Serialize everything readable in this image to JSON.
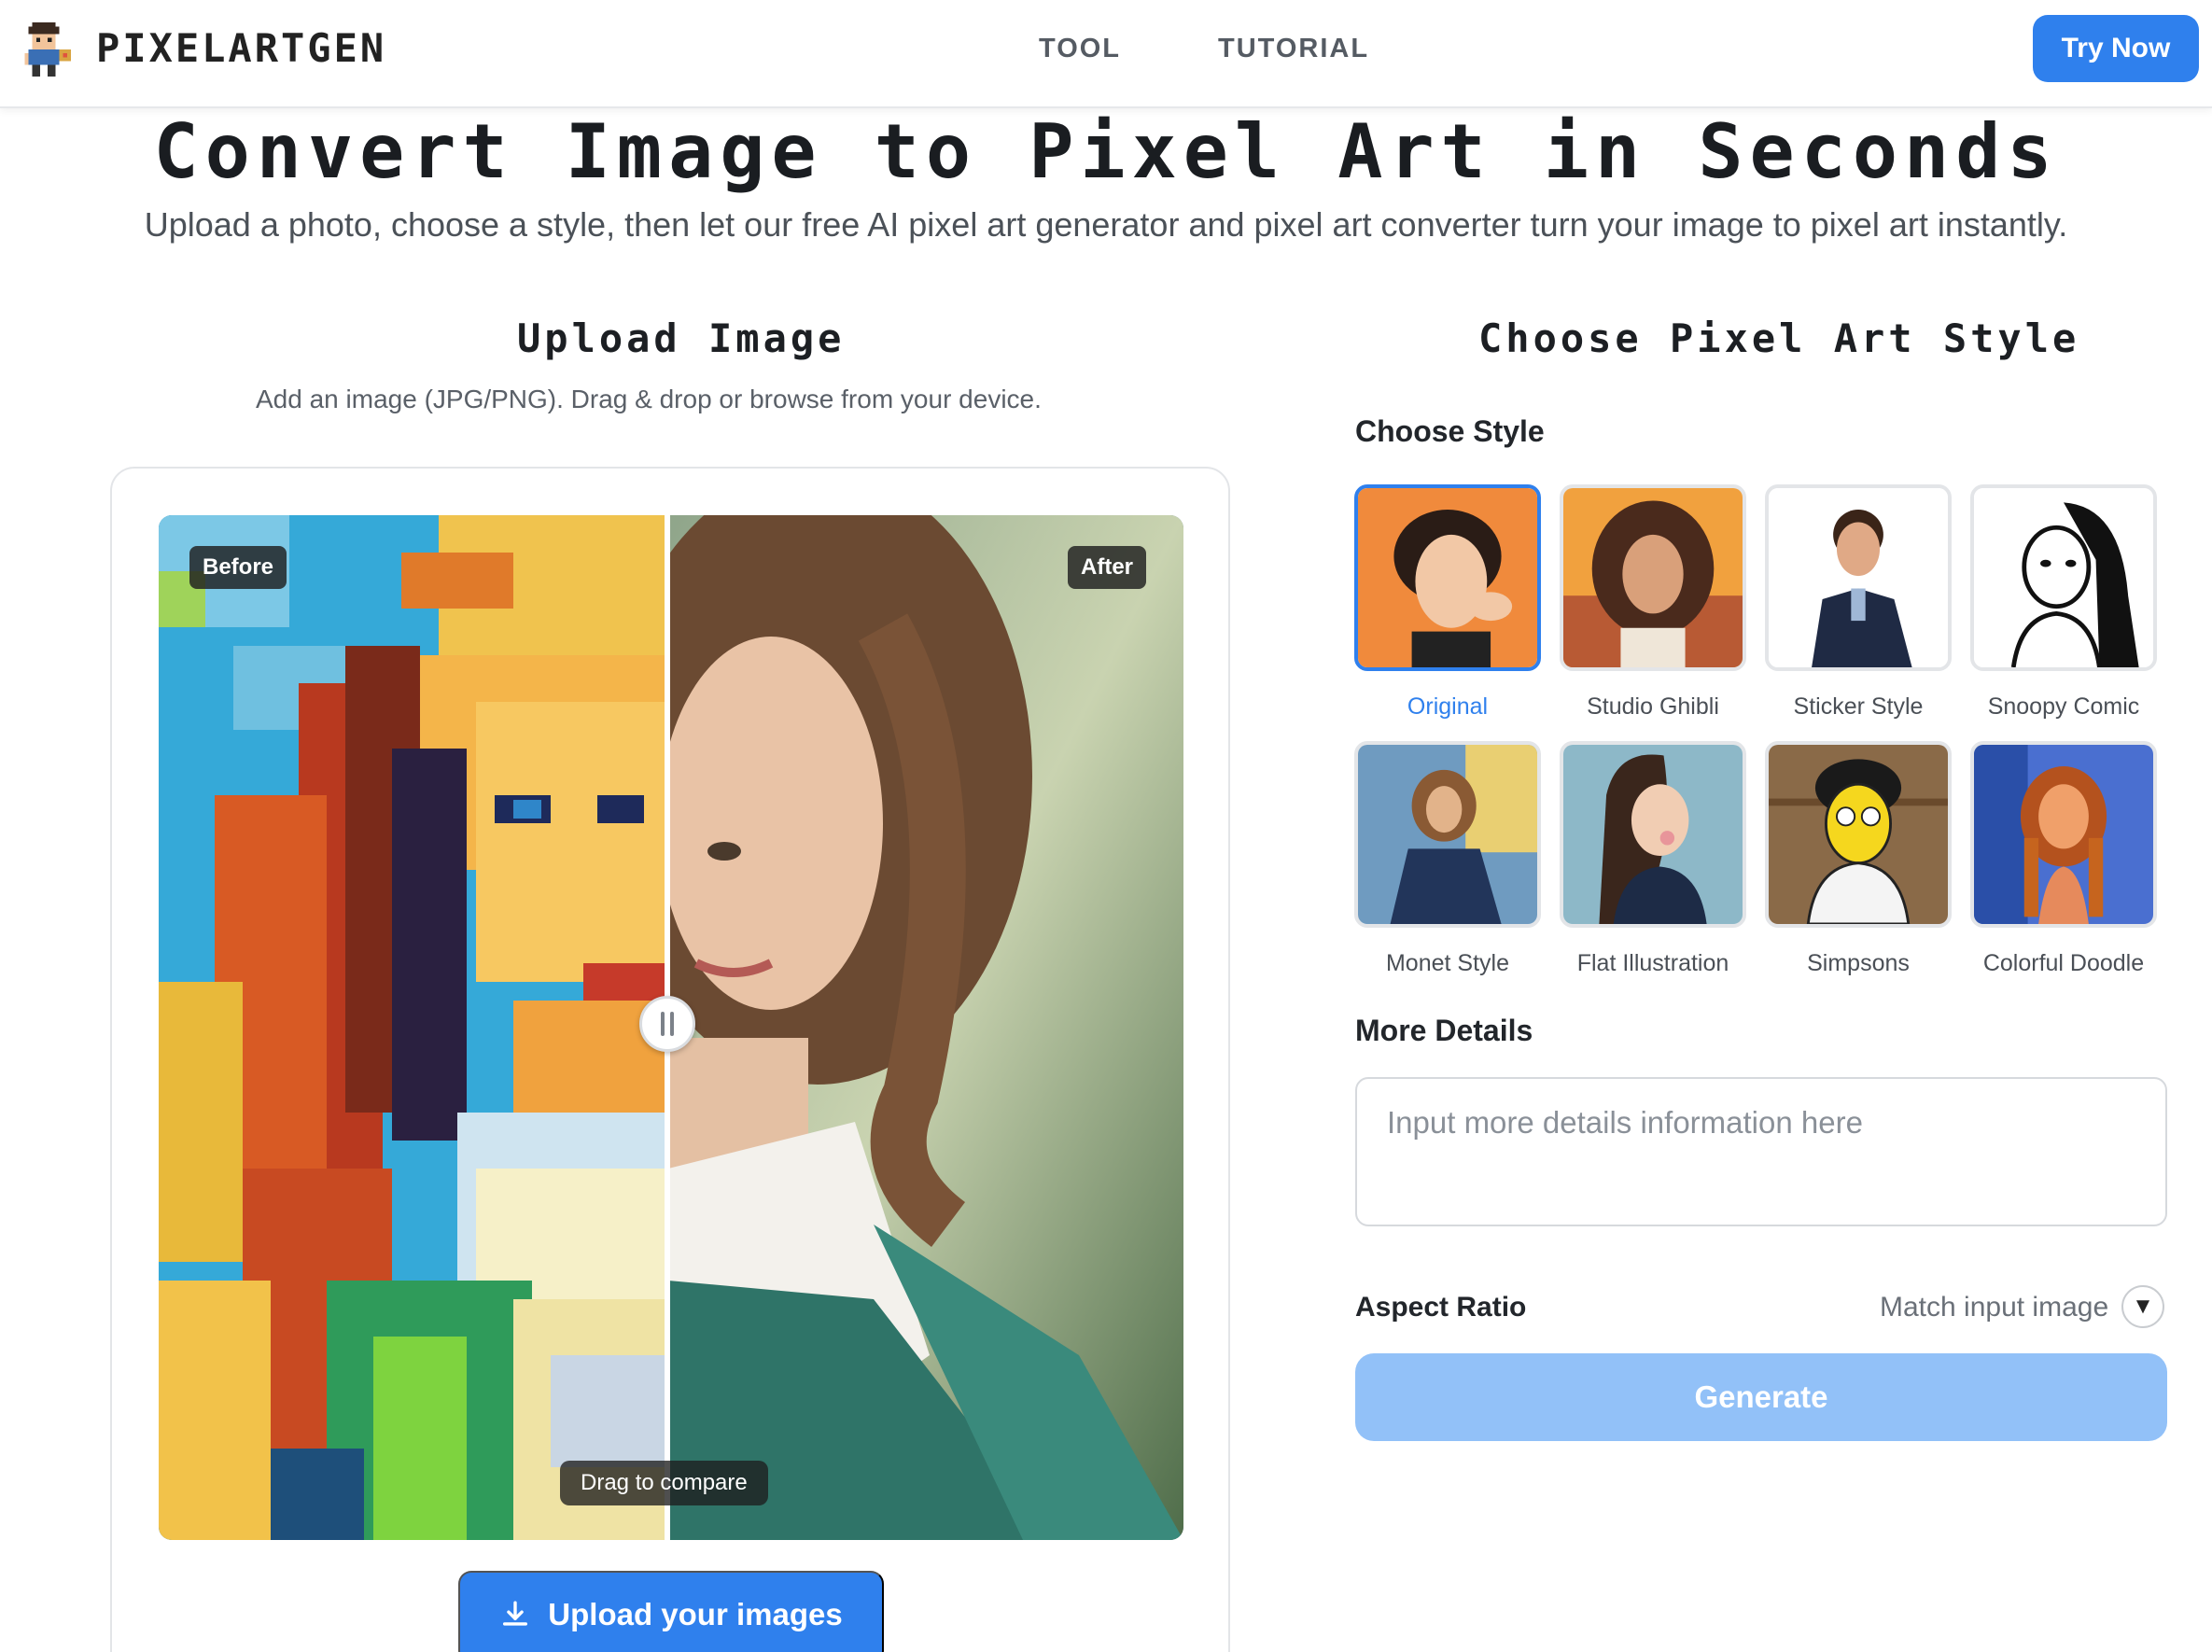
{
  "header": {
    "brand": "PIXELARTGEN",
    "nav": [
      "TOOL",
      "TUTORIAL"
    ],
    "try_label": "Try Now"
  },
  "hero": {
    "title": "Convert Image to Pixel Art in Seconds",
    "subtitle": "Upload a photo, choose a style, then let our free AI pixel art generator and pixel art converter turn your image to pixel art instantly."
  },
  "upload": {
    "title": "Upload Image",
    "description": "Add an image (JPG/PNG). Drag & drop or browse from your device.",
    "before_label": "Before",
    "after_label": "After",
    "drag_hint": "Drag to compare",
    "button_label": "Upload your images"
  },
  "style_panel": {
    "title": "Choose Pixel Art Style",
    "choose_label": "Choose Style",
    "styles": [
      {
        "name": "Original",
        "selected": true
      },
      {
        "name": "Studio Ghibli",
        "selected": false
      },
      {
        "name": "Sticker Style",
        "selected": false
      },
      {
        "name": "Snoopy Comic",
        "selected": false
      },
      {
        "name": "Monet Style",
        "selected": false
      },
      {
        "name": "Flat Illustration",
        "selected": false
      },
      {
        "name": "Simpsons",
        "selected": false
      },
      {
        "name": "Colorful Doodle",
        "selected": false
      }
    ],
    "more_details_label": "More Details",
    "details_placeholder": "Input more details information here",
    "aspect_label": "Aspect Ratio",
    "aspect_value": "Match input image",
    "generate_label": "Generate"
  },
  "colors": {
    "accent": "#2f80ed",
    "generate_disabled": "#92c1f8"
  }
}
